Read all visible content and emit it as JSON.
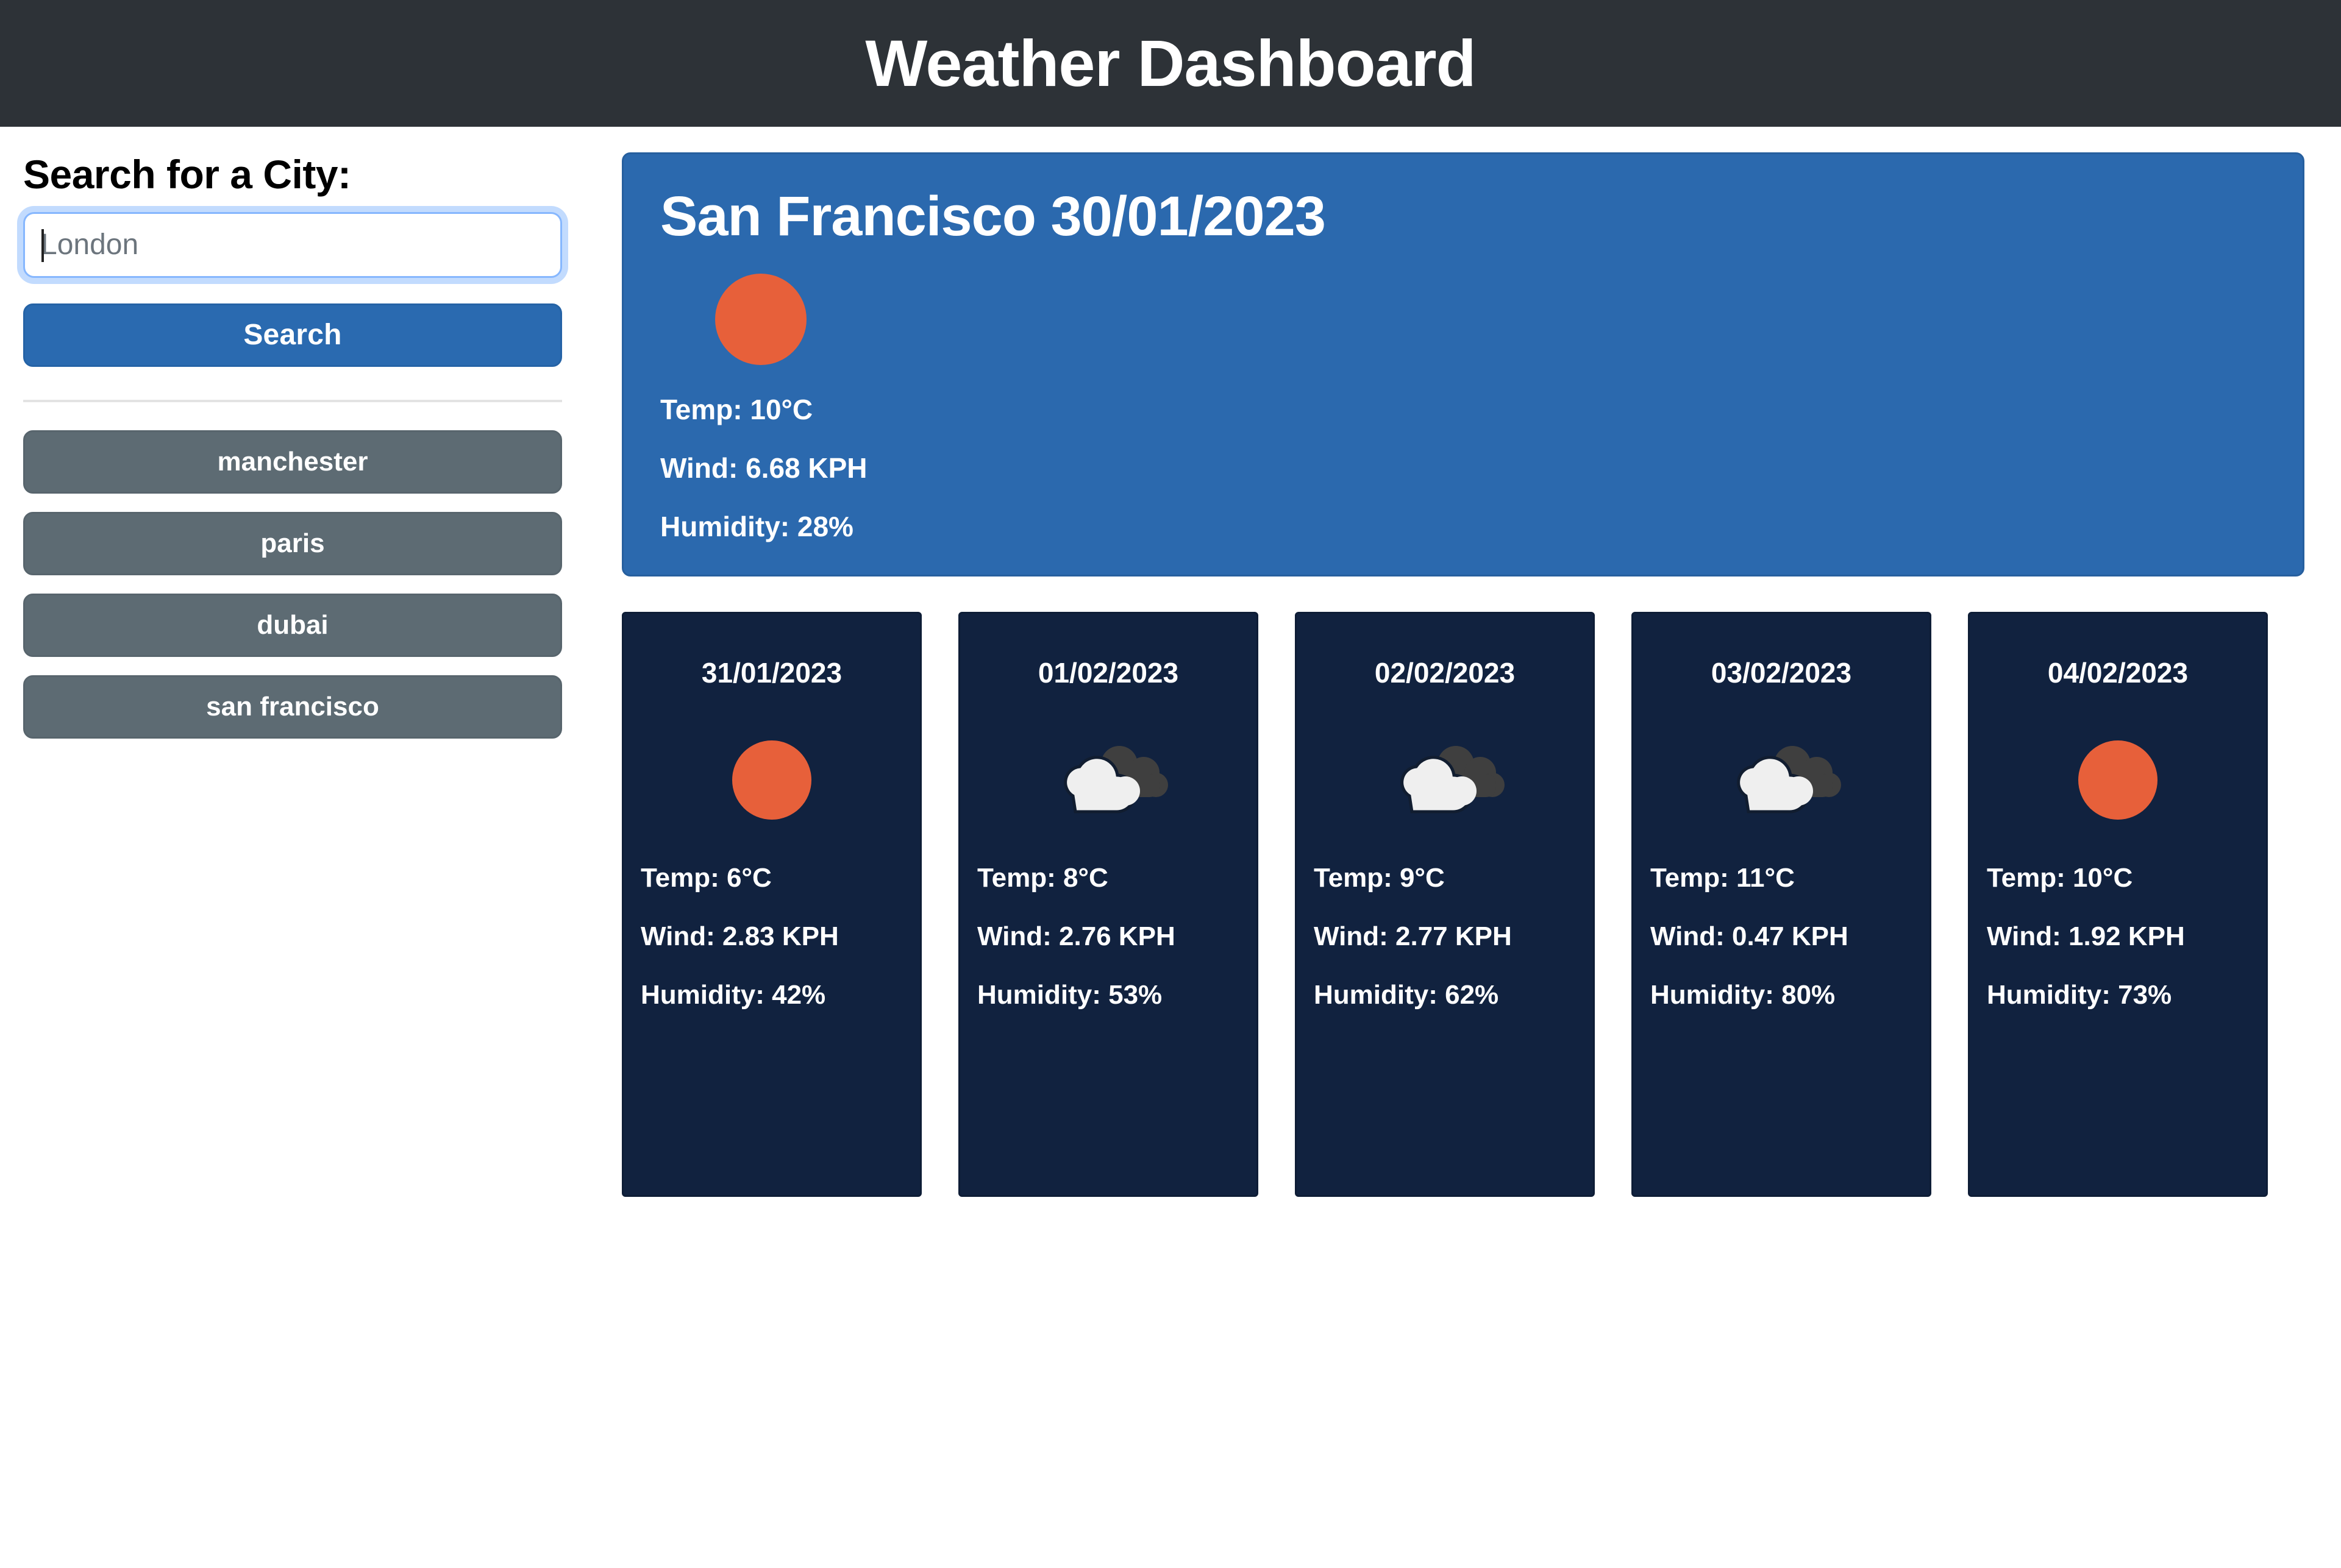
{
  "header": {
    "title": "Weather Dashboard",
    "background_color": "#2d3237"
  },
  "sidebar": {
    "heading": "Search for a City:",
    "search": {
      "placeholder": "London",
      "value": "",
      "button_label": "Search",
      "button_color": "#2a6ab0"
    },
    "history_label": "search-history",
    "history": [
      {
        "label": "manchester"
      },
      {
        "label": "paris"
      },
      {
        "label": "dubai"
      },
      {
        "label": "san francisco"
      }
    ],
    "history_button_color": "#5d6b73"
  },
  "current": {
    "city": "San Francisco",
    "date": "30/01/2023",
    "title": "San Francisco 30/01/2023",
    "icon": "sun-icon",
    "temp": "Temp: 10°C",
    "wind": "Wind: 6.68 KPH",
    "humidity": "Humidity: 28%",
    "background_color": "#2b69ae",
    "accent_color": "#e7603a"
  },
  "forecast": {
    "card_background_color": "#11223f",
    "days": [
      {
        "date": "31/01/2023",
        "icon": "sun-icon",
        "temp": "Temp: 6°C",
        "wind": "Wind: 2.83 KPH",
        "humidity": "Humidity: 42%"
      },
      {
        "date": "01/02/2023",
        "icon": "broken-clouds-icon",
        "temp": "Temp: 8°C",
        "wind": "Wind: 2.76 KPH",
        "humidity": "Humidity: 53%"
      },
      {
        "date": "02/02/2023",
        "icon": "broken-clouds-icon",
        "temp": "Temp: 9°C",
        "wind": "Wind: 2.77 KPH",
        "humidity": "Humidity: 62%"
      },
      {
        "date": "03/02/2023",
        "icon": "broken-clouds-icon",
        "temp": "Temp: 11°C",
        "wind": "Wind: 0.47 KPH",
        "humidity": "Humidity: 80%"
      },
      {
        "date": "04/02/2023",
        "icon": "sun-icon",
        "temp": "Temp: 10°C",
        "wind": "Wind: 1.92 KPH",
        "humidity": "Humidity: 73%"
      }
    ]
  }
}
